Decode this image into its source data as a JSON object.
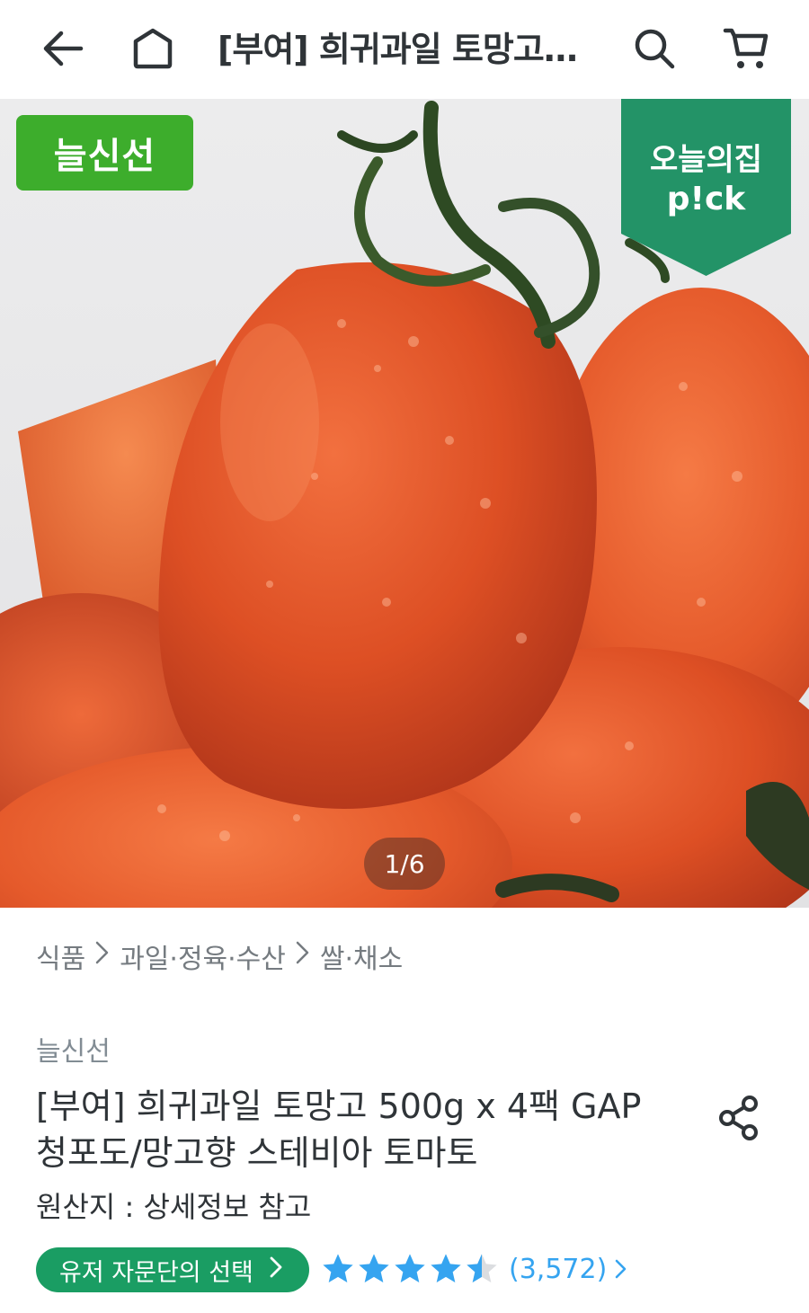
{
  "header": {
    "back_icon": "arrow-left-icon",
    "home_icon": "home-icon",
    "title": "[부여] 희귀과일 토망고…",
    "search_icon": "search-icon",
    "cart_icon": "cart-icon"
  },
  "hero": {
    "fresh_badge": "늘신선",
    "pick_badge_line1": "오늘의집",
    "pick_badge_line2": "p!ck",
    "counter": "1/6",
    "colors": {
      "fresh_badge": "#3dad2c",
      "pick_badge": "#239367"
    }
  },
  "breadcrumb": {
    "items": [
      "식품",
      "과일·정육·수산",
      "쌀·채소"
    ],
    "separator_icon": "chevron-right-icon"
  },
  "product": {
    "brand": "늘신선",
    "title": "[부여] 희귀과일 토망고 500g x 4팩 GAP 청포도/망고향 스테비아 토마토",
    "origin": "원산지 : 상세정보 참고",
    "share_icon": "share-icon",
    "advisor_pill": "유저 자문단의 선택",
    "rating_stars": 4.5,
    "review_count": "(3,572)",
    "colors": {
      "pill": "#1a9d63",
      "star": "#35a4f0"
    }
  }
}
